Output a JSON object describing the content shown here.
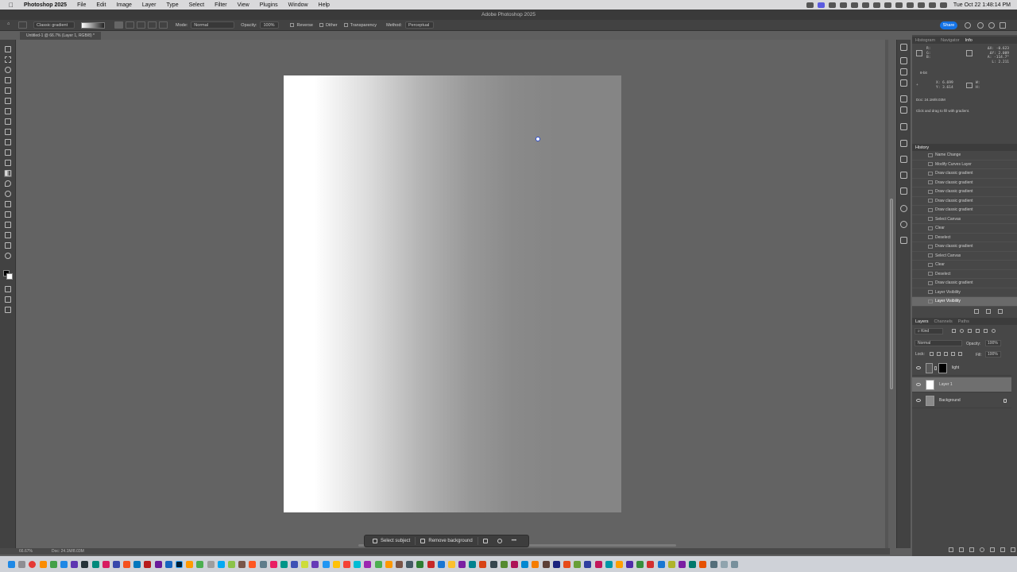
{
  "menubar": {
    "app_name": "Photoshop 2025",
    "items": [
      "File",
      "Edit",
      "Image",
      "Layer",
      "Type",
      "Select",
      "Filter",
      "View",
      "Plugins",
      "Window",
      "Help"
    ],
    "clock": "Tue Oct 22  1:48:14 PM"
  },
  "titlebar": {
    "title": "Adobe Photoshop 2025"
  },
  "options": {
    "preset": "Classic gradient",
    "mode_label": "Mode:",
    "mode_value": "Normal",
    "opacity_label": "Opacity:",
    "opacity_value": "100%",
    "reverse": "Reverse",
    "dither": "Dither",
    "transparency": "Transparency",
    "method_label": "Method:",
    "method_value": "Perceptual",
    "share": "Share"
  },
  "document": {
    "tab_title": "Untitled-1 @ 66.7% (Layer 1, RGB/8) *"
  },
  "contextual_bar": {
    "select_subject": "Select subject",
    "remove_background": "Remove background"
  },
  "status": {
    "zoom": "66.67%",
    "doc_size": "Doc: 24.1M/8.03M"
  },
  "info_panel": {
    "tabs": [
      "Histogram",
      "Navigator",
      "Info"
    ],
    "rgb_labels": "R:\nG:\nB:",
    "bit": "8-bit",
    "deltas": "ΔX: -0.623\nΔY: 2.009\nA: -114.7°\nL: 2.211",
    "xy": "X: 6.699\nY: 3.614",
    "wh": "W:\nH:",
    "doc": "Doc: 24.1M/8.03M",
    "hint": "Click and drag to fill with gradient."
  },
  "history": {
    "title": "History",
    "items": [
      "Name Change",
      "Modify Curves Layer",
      "Draw classic gradient",
      "Draw classic gradient",
      "Draw classic gradient",
      "Draw classic gradient",
      "Draw classic gradient",
      "Select Canvas",
      "Clear",
      "Deselect",
      "Draw classic gradient",
      "Select Canvas",
      "Clear",
      "Deselect",
      "Draw classic gradient",
      "Layer Visibility",
      "Layer Visibility"
    ]
  },
  "layers": {
    "tabs": [
      "Layers",
      "Channels",
      "Paths"
    ],
    "filter": "Kind",
    "blend": "Normal",
    "opacity_label": "Opacity:",
    "opacity_value": "100%",
    "lock_label": "Lock:",
    "fill_label": "Fill:",
    "fill_value": "100%",
    "rows": [
      {
        "name": "light"
      },
      {
        "name": "Layer 1"
      },
      {
        "name": "Background"
      }
    ]
  }
}
